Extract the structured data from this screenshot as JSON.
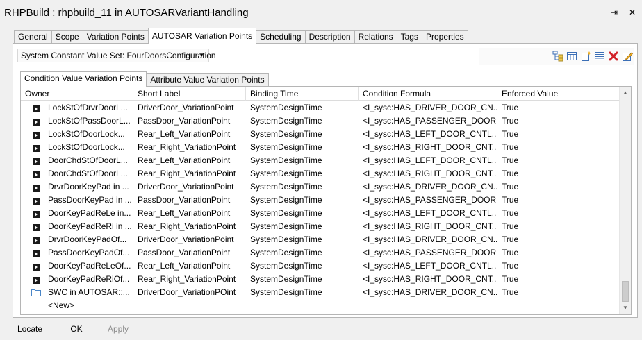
{
  "window": {
    "title": "RHPBuild : rhpbuild_11 in AUTOSARVariantHandling",
    "pin_glyph": "⇥",
    "close_glyph": "✕"
  },
  "tabs": [
    "General",
    "Scope",
    "Variation Points",
    "AUTOSAR Variation Points",
    "Scheduling",
    "Description",
    "Relations",
    "Tags",
    "Properties"
  ],
  "active_tab_index": 3,
  "value_set": {
    "label": "System Constant Value Set: FourDoorsConfiguration"
  },
  "toolbar_icons": [
    "tree-view-icon",
    "columns-icon",
    "new-item-icon",
    "table-icon",
    "delete-icon",
    "edit-icon"
  ],
  "colors": {
    "delete": "#d2232a",
    "accent_blue": "#3c6fb6",
    "folder_blue": "#4a86c8"
  },
  "subtabs": [
    "Condition Value Variation Points",
    "Attribute Value Variation Points"
  ],
  "active_subtab_index": 0,
  "grid": {
    "columns": [
      "Owner",
      "Short Label",
      "Binding Time",
      "Condition Formula",
      "Enforced Value"
    ],
    "rows": [
      {
        "owner": "LockStOfDrvrDoorL...",
        "label": "DriverDoor_VariationPoint",
        "binding": "SystemDesignTime",
        "formula": "<I_sysc:HAS_DRIVER_DOOR_CN...",
        "enforced": "True",
        "icon": "port-icon"
      },
      {
        "owner": "LockStOfPassDoorL...",
        "label": "PassDoor_VariationPoint",
        "binding": "SystemDesignTime",
        "formula": "<I_sysc:HAS_PASSENGER_DOOR...",
        "enforced": "True",
        "icon": "port-icon"
      },
      {
        "owner": "LockStOfDoorLock...",
        "label": "Rear_Left_VariationPoint",
        "binding": "SystemDesignTime",
        "formula": "<I_sysc:HAS_LEFT_DOOR_CNTL...",
        "enforced": "True",
        "icon": "port-icon"
      },
      {
        "owner": "LockStOfDoorLock...",
        "label": "Rear_Right_VariationPoint",
        "binding": "SystemDesignTime",
        "formula": "<I_sysc:HAS_RIGHT_DOOR_CNT...",
        "enforced": "True",
        "icon": "port-icon"
      },
      {
        "owner": "DoorChdStOfDoorL...",
        "label": "Rear_Left_VariationPoint",
        "binding": "SystemDesignTime",
        "formula": "<I_sysc:HAS_LEFT_DOOR_CNTL...",
        "enforced": "True",
        "icon": "port-icon"
      },
      {
        "owner": "DoorChdStOfDoorL...",
        "label": "Rear_Right_VariationPoint",
        "binding": "SystemDesignTime",
        "formula": "<I_sysc:HAS_RIGHT_DOOR_CNT...",
        "enforced": "True",
        "icon": "port-icon"
      },
      {
        "owner": "DrvrDoorKeyPad in ...",
        "label": "DriverDoor_VariationPoint",
        "binding": "SystemDesignTime",
        "formula": "<I_sysc:HAS_DRIVER_DOOR_CN...",
        "enforced": "True",
        "icon": "port-icon"
      },
      {
        "owner": "PassDoorKeyPad in ...",
        "label": "PassDoor_VariationPoint",
        "binding": "SystemDesignTime",
        "formula": "<I_sysc:HAS_PASSENGER_DOOR...",
        "enforced": "True",
        "icon": "port-icon"
      },
      {
        "owner": "DoorKeyPadReLe in...",
        "label": "Rear_Left_VariationPoint",
        "binding": "SystemDesignTime",
        "formula": "<I_sysc:HAS_LEFT_DOOR_CNTL...",
        "enforced": "True",
        "icon": "port-icon"
      },
      {
        "owner": "DoorKeyPadReRi in ...",
        "label": "Rear_Right_VariationPoint",
        "binding": "SystemDesignTime",
        "formula": "<I_sysc:HAS_RIGHT_DOOR_CNT...",
        "enforced": "True",
        "icon": "port-icon"
      },
      {
        "owner": "DrvrDoorKeyPadOf...",
        "label": "DriverDoor_VariationPoint",
        "binding": "SystemDesignTime",
        "formula": "<I_sysc:HAS_DRIVER_DOOR_CN...",
        "enforced": "True",
        "icon": "port-icon"
      },
      {
        "owner": "PassDoorKeyPadOf...",
        "label": "PassDoor_VariationPoint",
        "binding": "SystemDesignTime",
        "formula": "<I_sysc:HAS_PASSENGER_DOOR...",
        "enforced": "True",
        "icon": "port-icon"
      },
      {
        "owner": "DoorKeyPadReLeOf...",
        "label": "Rear_Left_VariationPoint",
        "binding": "SystemDesignTime",
        "formula": "<I_sysc:HAS_LEFT_DOOR_CNTL...",
        "enforced": "True",
        "icon": "port-icon"
      },
      {
        "owner": "DoorKeyPadReRiOf...",
        "label": "Rear_Right_VariationPoint",
        "binding": "SystemDesignTime",
        "formula": "<I_sysc:HAS_RIGHT_DOOR_CNT...",
        "enforced": "True",
        "icon": "port-icon"
      },
      {
        "owner": "SWC in AUTOSAR::...",
        "label": "DriverDoor_VariationPOint",
        "binding": "SystemDesignTime",
        "formula": "<I_sysc:HAS_DRIVER_DOOR_CN...",
        "enforced": "True",
        "icon": "folder-icon"
      }
    ],
    "new_row_label": "<New>"
  },
  "buttons": {
    "locate": "Locate",
    "ok": "OK",
    "apply": "Apply"
  }
}
